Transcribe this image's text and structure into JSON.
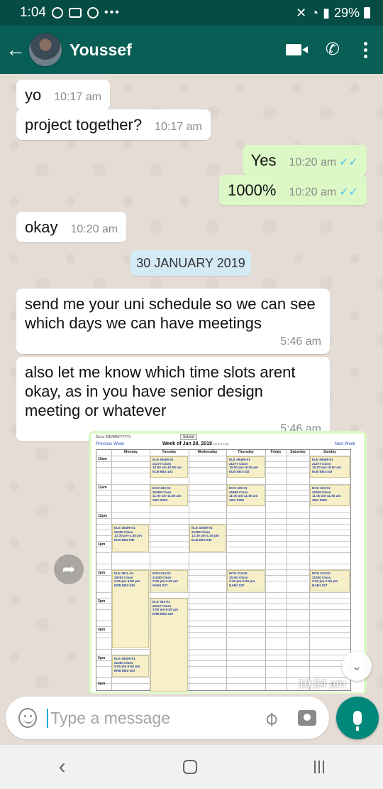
{
  "status_bar": {
    "time": "1:04",
    "battery": "29%"
  },
  "header": {
    "contact_name": "Youssef"
  },
  "messages": [
    {
      "dir": "in",
      "text": "yo",
      "time": "10:17 am"
    },
    {
      "dir": "in",
      "text": "project together?",
      "time": "10:17 am"
    },
    {
      "dir": "out",
      "text": "Yes",
      "time": "10:20 am"
    },
    {
      "dir": "out",
      "text": "1000%",
      "time": "10:20 am"
    },
    {
      "dir": "in",
      "text": "okay",
      "time": "10:20 am"
    },
    {
      "dir": "in",
      "text": "send me your uni schedule so we can see which days we can have meetings",
      "time": "5:46 am"
    },
    {
      "dir": "in",
      "text": "also let me know which time slots arent okay, as in you have senior design meeting or whatever",
      "time": "5:46 am"
    }
  ],
  "date_separator": "30 JANUARY 2019",
  "image_message": {
    "time": "10:24 am",
    "schedule": {
      "goto_label": "Go to (DD/MM/YYYY):",
      "submit_label": "Submit",
      "prev_week": "Previous Week",
      "next_week": "Next Week",
      "week_title": "Week of Jan 28, 2019",
      "week_sub": "(179 of 195)",
      "days": [
        "Monday",
        "Tuesday",
        "Wednesday",
        "Thursday",
        "Friday",
        "Saturday",
        "Sunday"
      ],
      "times": [
        "10am",
        "11am",
        "12pm",
        "1pm",
        "2pm",
        "3pm",
        "4pm",
        "5pm",
        "6pm"
      ],
      "classes": {
        "tue_10": [
          "ELE 49408-01",
          "21277 Class",
          "10:00 am-10:50 am",
          "ELB EB1-102"
        ],
        "thu_10": [
          "ELE 49408-01",
          "21277 Class",
          "10:00 am-10:50 am",
          "ELB EB1-102"
        ],
        "sun_10": [
          "ELE 49408-01",
          "21277 Class",
          "10:00 am-10:50 am",
          "ELB EB1-102"
        ],
        "tue_11": [
          "ECO 330-01",
          "20459 Class",
          "11:00 am-11:50 am",
          "SBA 0006"
        ],
        "thu_11": [
          "ECO 330-01",
          "20459 Class",
          "11:00 am-11:50 am",
          "SBA 0006"
        ],
        "sun_11": [
          "ECO 330-01",
          "20459 Class",
          "11:00 am-11:50 am",
          "SBA 0006"
        ],
        "mon_1230": [
          "ELE 49409-01",
          "21280 Class",
          "12:30 pm-1:45 pm",
          "ELB EB1-040"
        ],
        "wed_1230": [
          "ELE 49409-01",
          "21280 Class",
          "12:30 pm-1:45 pm",
          "ELB EB1-040"
        ],
        "mon_2": [
          "ELE 361L-01",
          "20205 Class",
          "2:00 pm-4:50 pm",
          "ERB EB2-030"
        ],
        "tue_2": [
          "MTH 213-02",
          "21030 Class",
          "2:00 pm-2:50 pm",
          "NAB1 007"
        ],
        "thu_2": [
          "MTH 213-02",
          "21030 Class",
          "2:00 pm-2:50 pm",
          "NAB1 007"
        ],
        "sun_2": [
          "MTH 213-02",
          "21030 Class",
          "2:00 pm-2:50 pm",
          "NAB1 007"
        ],
        "tue_3": [
          "ELE 491-01",
          "20217 Class",
          "3:00 pm-6:00 pm",
          "ERB EB2-216"
        ],
        "mon_5": [
          "ELE 49409-01",
          "21280 Class",
          "5:00 pm-5:50 pm",
          "ERB EB2-103"
        ]
      }
    }
  },
  "input": {
    "placeholder": "Type a message"
  }
}
